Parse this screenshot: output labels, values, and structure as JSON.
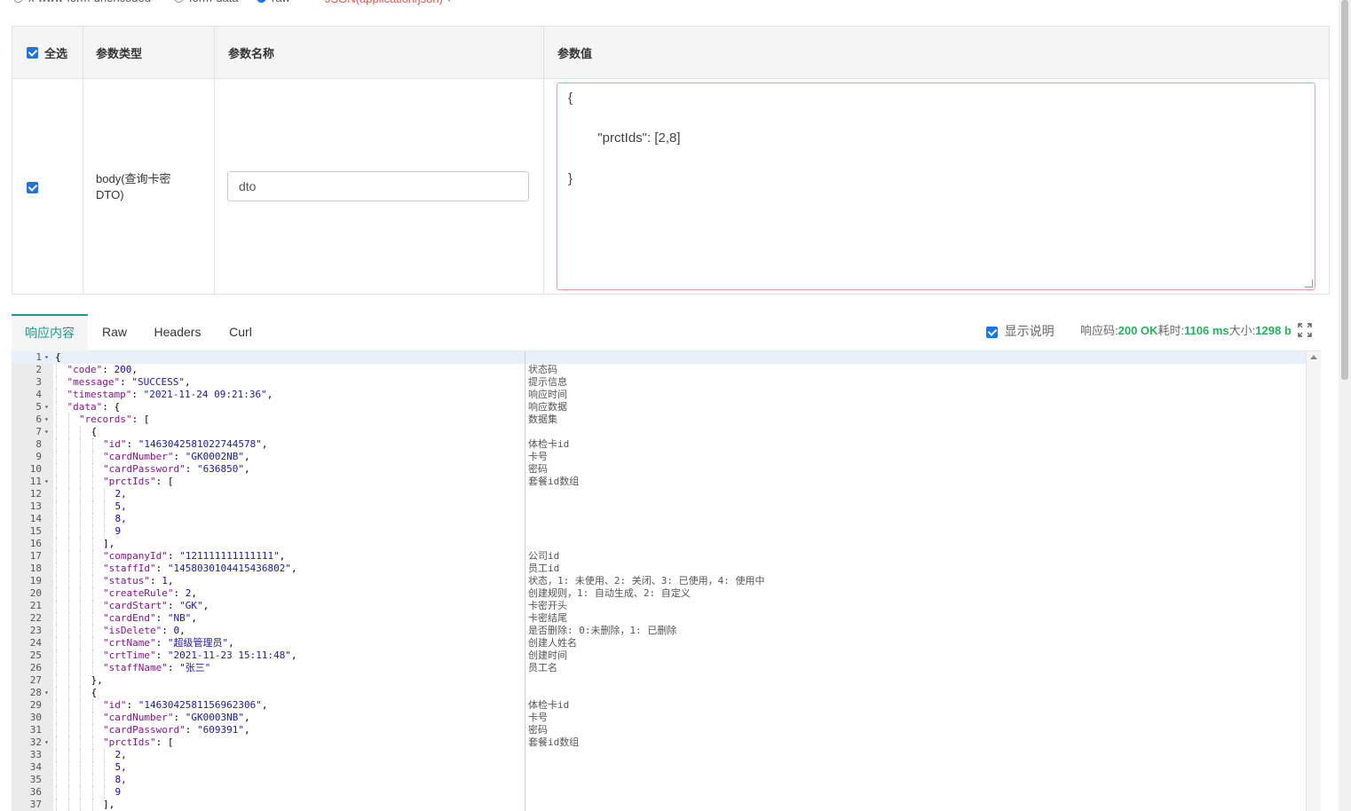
{
  "top_options": [
    {
      "label": "x-www-form-urlencoded",
      "checked": false
    },
    {
      "label": "form-data",
      "checked": false
    },
    {
      "label": "raw",
      "checked": true
    }
  ],
  "content_type": "JSON(application/json)",
  "params_table": {
    "headers": {
      "select_all": "全选",
      "param_type": "参数类型",
      "param_name": "参数名称",
      "param_value": "参数值"
    },
    "row": {
      "checked": true,
      "type": "body(查询卡密DTO)",
      "name": "dto",
      "value_lines": [
        "{",
        "        \"prctIds\": [2,8]",
        "}"
      ]
    }
  },
  "tabs": [
    "响应内容",
    "Raw",
    "Headers",
    "Curl"
  ],
  "active_tab": "响应内容",
  "show_desc_label": "显示说明",
  "response_meta": {
    "code_label": "响应码:",
    "code_value": "200 OK",
    "time_label": "耗时:",
    "time_value": "1106 ms",
    "size_label": "大小:",
    "size_value": "1298 b"
  },
  "code_lines": [
    {
      "n": "1",
      "fold": true,
      "indent": 0,
      "text": "{",
      "comment": ""
    },
    {
      "n": "2",
      "fold": false,
      "indent": 1,
      "key": "code",
      "val": "200",
      "vt": "n",
      "comma": true,
      "comment": "状态码"
    },
    {
      "n": "3",
      "fold": false,
      "indent": 1,
      "key": "message",
      "val": "\"SUCCESS\"",
      "vt": "s",
      "comma": true,
      "comment": "提示信息"
    },
    {
      "n": "4",
      "fold": false,
      "indent": 1,
      "key": "timestamp",
      "val": "\"2021-11-24 09:21:36\"",
      "vt": "s",
      "comma": true,
      "comment": "响应时间"
    },
    {
      "n": "5",
      "fold": true,
      "indent": 1,
      "key": "data",
      "val": "{",
      "vt": "p",
      "comma": false,
      "comment": "响应数据"
    },
    {
      "n": "6",
      "fold": true,
      "indent": 2,
      "key": "records",
      "val": "[",
      "vt": "p",
      "comma": false,
      "comment": "数据集"
    },
    {
      "n": "7",
      "fold": true,
      "indent": 3,
      "text": "{",
      "comment": ""
    },
    {
      "n": "8",
      "fold": false,
      "indent": 4,
      "key": "id",
      "val": "\"1463042581022744578\"",
      "vt": "s",
      "comma": true,
      "comment": "体检卡id"
    },
    {
      "n": "9",
      "fold": false,
      "indent": 4,
      "key": "cardNumber",
      "val": "\"GK0002NB\"",
      "vt": "s",
      "comma": true,
      "comment": "卡号"
    },
    {
      "n": "10",
      "fold": false,
      "indent": 4,
      "key": "cardPassword",
      "val": "\"636850\"",
      "vt": "s",
      "comma": true,
      "comment": "密码"
    },
    {
      "n": "11",
      "fold": true,
      "indent": 4,
      "key": "prctIds",
      "val": "[",
      "vt": "p",
      "comma": false,
      "comment": "套餐id数组"
    },
    {
      "n": "12",
      "fold": false,
      "indent": 5,
      "text": "2,",
      "vt": "n",
      "comment": ""
    },
    {
      "n": "13",
      "fold": false,
      "indent": 5,
      "text": "5,",
      "vt": "n",
      "comment": ""
    },
    {
      "n": "14",
      "fold": false,
      "indent": 5,
      "text": "8,",
      "vt": "n",
      "comment": ""
    },
    {
      "n": "15",
      "fold": false,
      "indent": 5,
      "text": "9",
      "vt": "n",
      "comment": ""
    },
    {
      "n": "16",
      "fold": false,
      "indent": 4,
      "text": "],",
      "comment": ""
    },
    {
      "n": "17",
      "fold": false,
      "indent": 4,
      "key": "companyId",
      "val": "\"121111111111111\"",
      "vt": "s",
      "comma": true,
      "comment": "公司id"
    },
    {
      "n": "18",
      "fold": false,
      "indent": 4,
      "key": "staffId",
      "val": "\"1458030104415436802\"",
      "vt": "s",
      "comma": true,
      "comment": "员工id"
    },
    {
      "n": "19",
      "fold": false,
      "indent": 4,
      "key": "status",
      "val": "1",
      "vt": "n",
      "comma": true,
      "comment": "状态，1: 未使用、2: 关闭、3: 已使用，4: 使用中"
    },
    {
      "n": "20",
      "fold": false,
      "indent": 4,
      "key": "createRule",
      "val": "2",
      "vt": "n",
      "comma": true,
      "comment": "创建规则，1: 自动生成、2: 自定义"
    },
    {
      "n": "21",
      "fold": false,
      "indent": 4,
      "key": "cardStart",
      "val": "\"GK\"",
      "vt": "s",
      "comma": true,
      "comment": "卡密开头"
    },
    {
      "n": "22",
      "fold": false,
      "indent": 4,
      "key": "cardEnd",
      "val": "\"NB\"",
      "vt": "s",
      "comma": true,
      "comment": "卡密结尾"
    },
    {
      "n": "23",
      "fold": false,
      "indent": 4,
      "key": "isDelete",
      "val": "0",
      "vt": "n",
      "comma": true,
      "comment": "是否删除: 0:未删除，1: 已删除"
    },
    {
      "n": "24",
      "fold": false,
      "indent": 4,
      "key": "crtName",
      "val": "\"超级管理员\"",
      "vt": "s",
      "comma": true,
      "comment": "创建人姓名"
    },
    {
      "n": "25",
      "fold": false,
      "indent": 4,
      "key": "crtTime",
      "val": "\"2021-11-23 15:11:48\"",
      "vt": "s",
      "comma": true,
      "comment": "创建时间"
    },
    {
      "n": "26",
      "fold": false,
      "indent": 4,
      "key": "staffName",
      "val": "\"张三\"",
      "vt": "s",
      "comma": false,
      "comment": "员工名"
    },
    {
      "n": "27",
      "fold": false,
      "indent": 3,
      "text": "},",
      "comment": ""
    },
    {
      "n": "28",
      "fold": true,
      "indent": 3,
      "text": "{",
      "comment": ""
    },
    {
      "n": "29",
      "fold": false,
      "indent": 4,
      "key": "id",
      "val": "\"1463042581156962306\"",
      "vt": "s",
      "comma": true,
      "comment": "体检卡id"
    },
    {
      "n": "30",
      "fold": false,
      "indent": 4,
      "key": "cardNumber",
      "val": "\"GK0003NB\"",
      "vt": "s",
      "comma": true,
      "comment": "卡号"
    },
    {
      "n": "31",
      "fold": false,
      "indent": 4,
      "key": "cardPassword",
      "val": "\"609391\"",
      "vt": "s",
      "comma": true,
      "comment": "密码"
    },
    {
      "n": "32",
      "fold": true,
      "indent": 4,
      "key": "prctIds",
      "val": "[",
      "vt": "p",
      "comma": false,
      "comment": "套餐id数组"
    },
    {
      "n": "33",
      "fold": false,
      "indent": 5,
      "text": "2,",
      "vt": "n",
      "comment": ""
    },
    {
      "n": "34",
      "fold": false,
      "indent": 5,
      "text": "5,",
      "vt": "n",
      "comment": ""
    },
    {
      "n": "35",
      "fold": false,
      "indent": 5,
      "text": "8,",
      "vt": "n",
      "comment": ""
    },
    {
      "n": "36",
      "fold": false,
      "indent": 5,
      "text": "9",
      "vt": "n",
      "comment": ""
    },
    {
      "n": "37",
      "fold": false,
      "indent": 4,
      "text": "],",
      "comment": ""
    }
  ]
}
